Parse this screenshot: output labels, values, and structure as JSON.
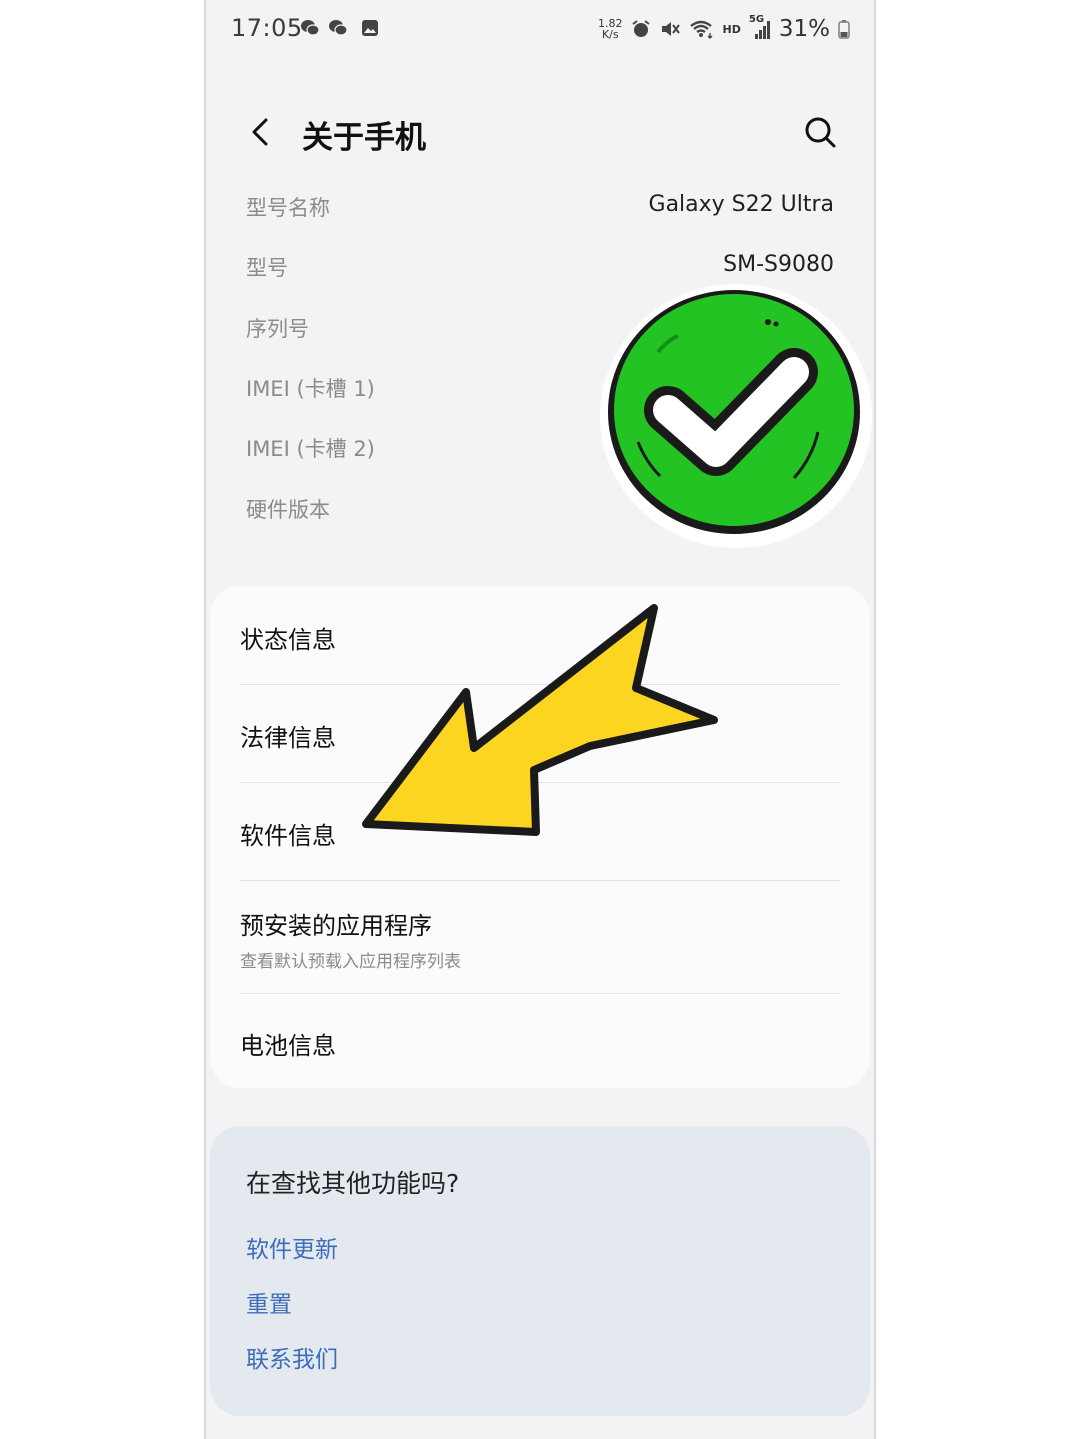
{
  "status_bar": {
    "time": "17:05",
    "net_speed_value": "1.82",
    "net_speed_unit": "K/s",
    "network_type": "HD",
    "signal_type": "5G",
    "battery_percent": "31%",
    "notification_icons": [
      "wechat-icon",
      "wechat-icon",
      "gallery-icon"
    ],
    "right_icons": [
      "alarm-icon",
      "mute-icon",
      "wifi-icon",
      "hd-icon",
      "signal-5g-icon",
      "battery-icon"
    ]
  },
  "header": {
    "title": "关于手机",
    "back_icon": "chevron-left-icon",
    "search_icon": "search-icon"
  },
  "device_info": [
    {
      "label": "型号名称",
      "value": "Galaxy S22 Ultra"
    },
    {
      "label": "型号",
      "value": "SM-S9080"
    },
    {
      "label": "序列号",
      "value": ""
    },
    {
      "label": "IMEI (卡槽 1)",
      "value": ""
    },
    {
      "label": "IMEI (卡槽 2)",
      "value": ""
    },
    {
      "label": "硬件版本",
      "value": ""
    }
  ],
  "menu": [
    {
      "label": "状态信息"
    },
    {
      "label": "法律信息"
    },
    {
      "label": "软件信息"
    },
    {
      "label": "预安装的应用程序",
      "sublabel": "查看默认预载入应用程序列表"
    },
    {
      "label": "电池信息"
    }
  ],
  "looking_for": {
    "title": "在查找其他功能吗?",
    "links": [
      "软件更新",
      "重置",
      "联系我们"
    ]
  },
  "overlays": {
    "checkmark_sticker": {
      "color": "#22c322",
      "icon": "checkmark-icon"
    },
    "arrow_sticker": {
      "color": "#fbd51f",
      "icon": "arrow-icon"
    }
  }
}
